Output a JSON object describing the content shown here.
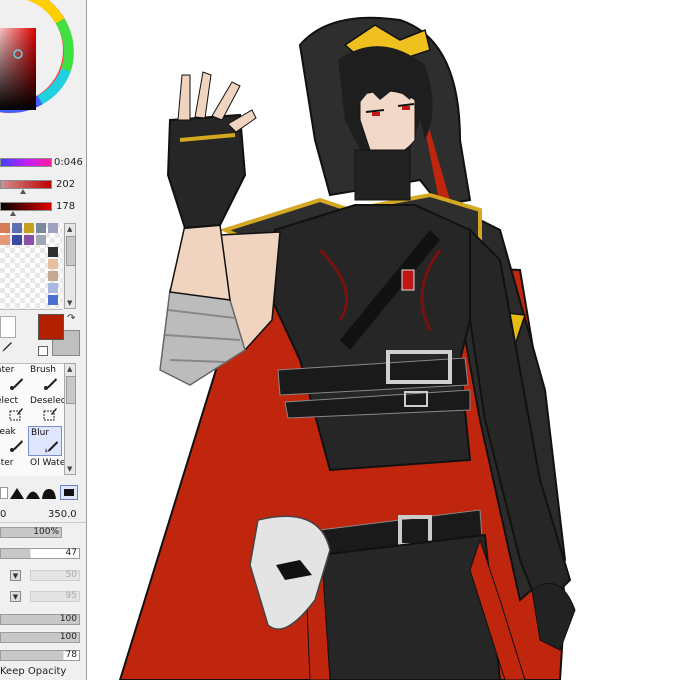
{
  "color_panel": {
    "sliders": [
      {
        "name": "hue",
        "value": "0:046"
      },
      {
        "name": "saturation",
        "value": "202"
      },
      {
        "name": "value",
        "value": "178"
      }
    ],
    "main_color": "#b32000",
    "sub_color": "#bfbfbf"
  },
  "swatches": [
    "#d47c5a",
    "#e69878",
    "#5c6fb0",
    "#3b4aa0",
    "#c8a020",
    "#8a50a8",
    "#7a8a9c",
    "#a0a8b4",
    "#303030",
    "#e8c0a0",
    "#c4a890",
    "#808080",
    "#4a70d0",
    "#a8b8e0"
  ],
  "tools": [
    {
      "label": "ater"
    },
    {
      "label": "Brush"
    },
    {
      "label": "elect"
    },
    {
      "label": "Deselect"
    },
    {
      "label": "reak"
    },
    {
      "label": "Blur"
    },
    {
      "label": "ster"
    },
    {
      "label": "Ol Wate"
    }
  ],
  "brush_settings": {
    "size_max": "0",
    "size_value": "350.0",
    "min_size": "100%",
    "density": "47",
    "blending_dim": "50",
    "dilution_dim": "95",
    "persistence_a": "100",
    "persistence_b": "100",
    "last_value": "78",
    "keep_opacity": "Keep Opacity"
  }
}
